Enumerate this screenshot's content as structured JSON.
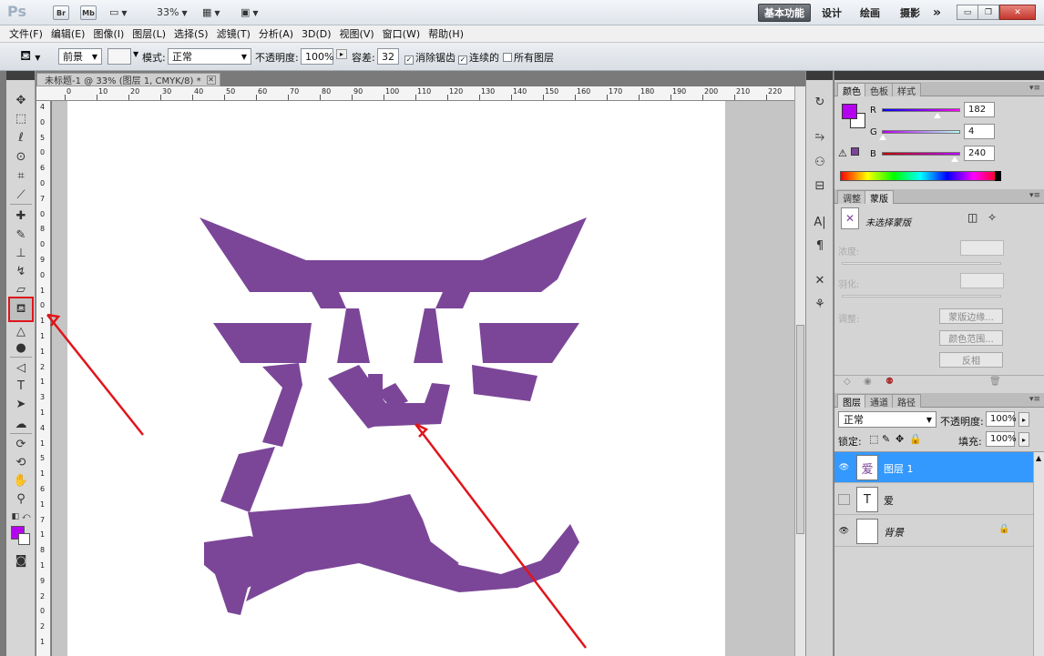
{
  "app": {
    "logo": "Ps",
    "title_buttons": [
      "Br",
      "Mb"
    ],
    "zoom": "33%",
    "workspaces": [
      "基本功能",
      "设计",
      "绘画",
      "摄影"
    ],
    "more": "»"
  },
  "menu": [
    "文件(F)",
    "编辑(E)",
    "图像(I)",
    "图层(L)",
    "选择(S)",
    "滤镜(T)",
    "分析(A)",
    "3D(D)",
    "视图(V)",
    "窗口(W)",
    "帮助(H)"
  ],
  "options": {
    "fill_source": "前景",
    "mode_label": "模式:",
    "mode_value": "正常",
    "opacity_label": "不透明度:",
    "opacity_value": "100%",
    "tolerance_label": "容差:",
    "tolerance_value": "32",
    "antialias_label": "消除锯齿",
    "contiguous_label": "连续的",
    "all_layers_label": "所有图层"
  },
  "document": {
    "tab_title": "未标题-1 @ 33% (图层 1, CMYK/8) *",
    "ruler_h": [
      "0",
      "10",
      "20",
      "30",
      "40",
      "50",
      "60",
      "70",
      "80",
      "90",
      "100",
      "110",
      "120",
      "130",
      "140",
      "150",
      "160",
      "170",
      "180",
      "190",
      "200",
      "210",
      "220"
    ],
    "ruler_v": [
      "4",
      "0",
      "5",
      "0",
      "6",
      "0",
      "7",
      "0",
      "8",
      "0",
      "9",
      "0",
      "1",
      "0",
      "1",
      "1",
      "1",
      "2",
      "1",
      "3",
      "1",
      "4",
      "1",
      "5",
      "1",
      "6",
      "1",
      "7",
      "1",
      "8",
      "1",
      "9",
      "2",
      "0",
      "2",
      "1"
    ],
    "glyph_color": "#7b4698"
  },
  "color_panel": {
    "tabs": [
      "颜色",
      "色板",
      "样式"
    ],
    "foreground": "#b600f0",
    "r_label": "R",
    "r_value": "182",
    "g_label": "G",
    "g_value": "4",
    "b_label": "B",
    "b_value": "240"
  },
  "masks_panel": {
    "tabs": [
      "调整",
      "蒙版"
    ],
    "title": "未选择蒙版",
    "density_label": "浓度:",
    "feather_label": "羽化:",
    "refine_label": "调整:",
    "btn_edge": "蒙版边缘...",
    "btn_color_range": "颜色范围...",
    "btn_invert": "反相"
  },
  "layers_panel": {
    "tabs": [
      "图层",
      "通道",
      "路径"
    ],
    "blend_mode": "正常",
    "opacity_label": "不透明度:",
    "opacity_value": "100%",
    "lock_label": "锁定:",
    "fill_label": "填充:",
    "fill_value": "100%",
    "layers": [
      {
        "name": "图层 1",
        "thumb": "爱",
        "visible": true,
        "selected": true
      },
      {
        "name": "爱",
        "thumb": "T",
        "visible": false,
        "selected": false
      },
      {
        "name": "背景",
        "thumb": "",
        "visible": true,
        "selected": false,
        "locked": true
      }
    ]
  },
  "colors": {
    "selection_highlight": "#3399ff",
    "annotation_red": "#e0151b"
  }
}
